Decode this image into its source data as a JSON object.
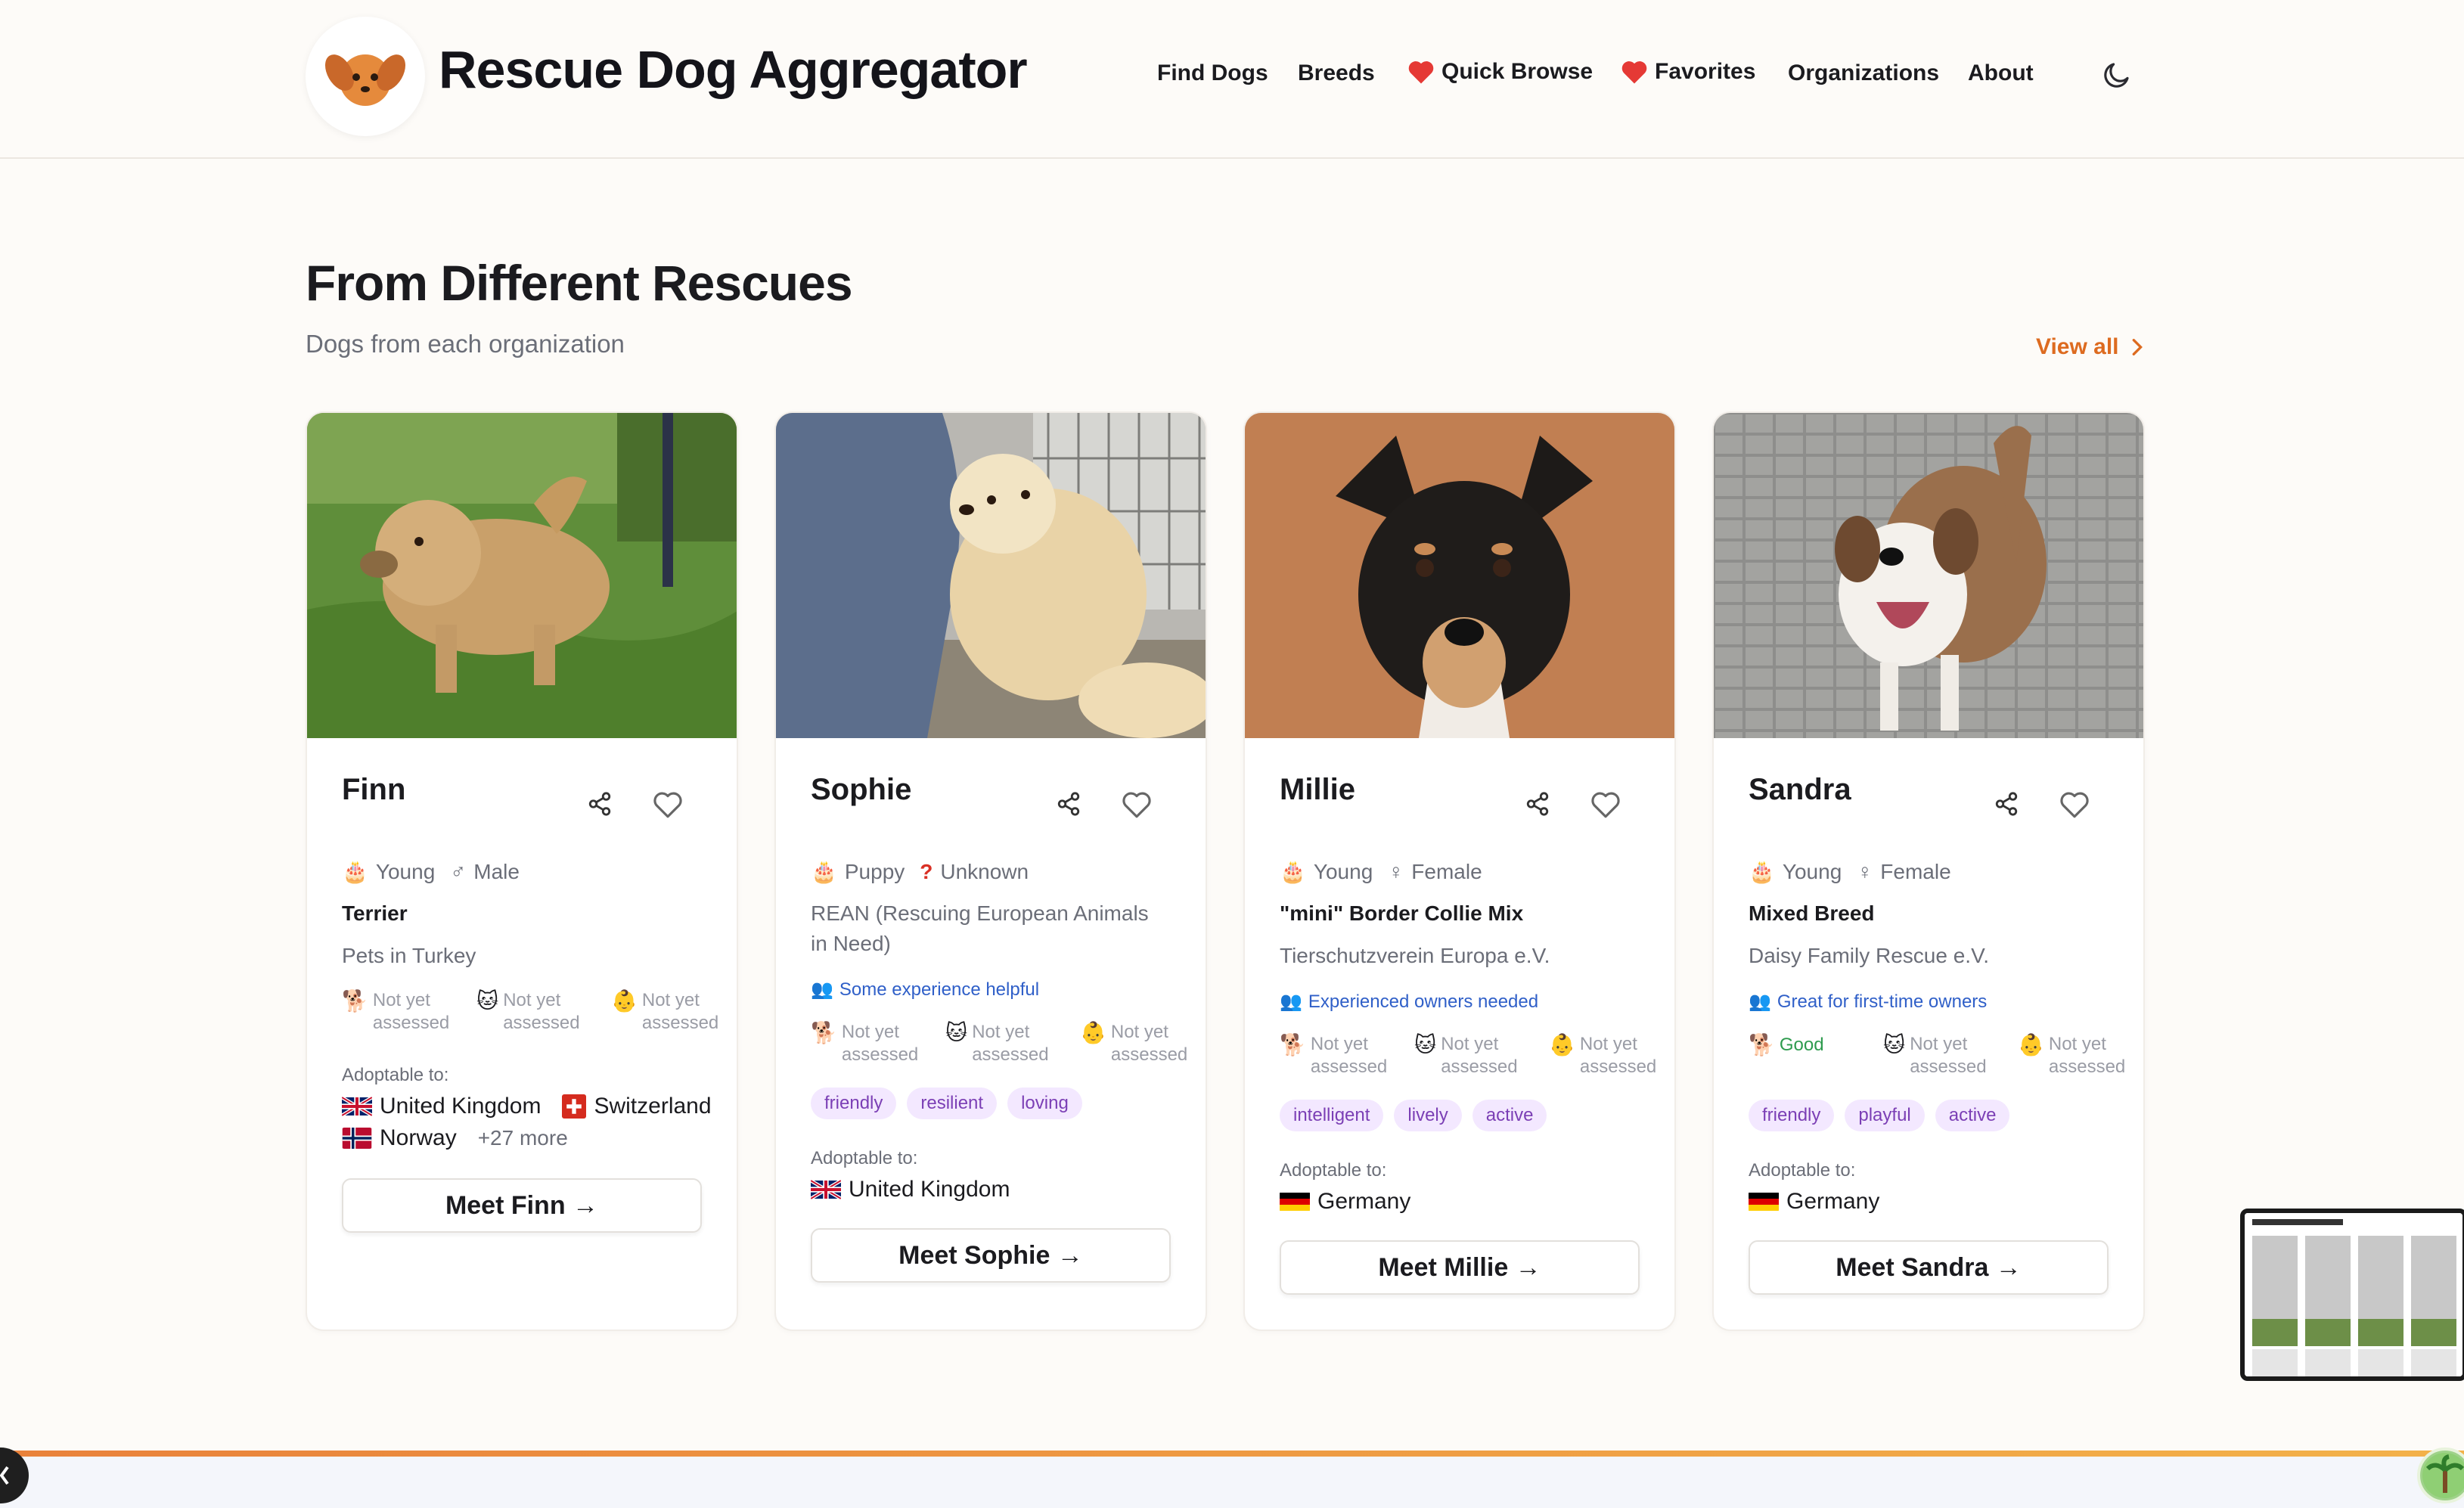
{
  "header": {
    "brand": "Rescue Dog Aggregator",
    "nav": [
      {
        "label": "Find Dogs",
        "icon": ""
      },
      {
        "label": "Breeds",
        "icon": ""
      },
      {
        "label": "Quick Browse",
        "icon": "heart-icon"
      },
      {
        "label": "Favorites",
        "icon": "heart-icon"
      },
      {
        "label": "Organizations",
        "icon": ""
      },
      {
        "label": "About",
        "icon": ""
      }
    ],
    "theme_icon": "moon-icon"
  },
  "section": {
    "title": "From Different Rescues",
    "subtitle": "Dogs from each organization",
    "view_all": "View all"
  },
  "colors": {
    "accent": "#dd6b20",
    "tag_bg": "#f3e8ff",
    "tag_text": "#7b3fb5",
    "experience": "#2f5fc8",
    "good": "#2e9b4e"
  },
  "cards": [
    {
      "name": "Finn",
      "age": "Young",
      "sex": "Male",
      "sex_icon": "male-icon",
      "breed": "Terrier",
      "org": "Pets in Turkey",
      "experience": "",
      "compat": [
        {
          "icon": "dog-icon",
          "text": "Not yet assessed"
        },
        {
          "icon": "cat-icon",
          "text": "Not yet assessed"
        },
        {
          "icon": "child-icon",
          "text": "Not yet assessed"
        }
      ],
      "tags": [],
      "adoptable_label": "Adoptable to:",
      "countries": [
        "United Kingdom",
        "Switzerland",
        "Norway"
      ],
      "more": "+27 more",
      "cta": "Meet Finn →"
    },
    {
      "name": "Sophie",
      "age": "Puppy",
      "sex": "Unknown",
      "sex_icon": "question-icon",
      "breed": "",
      "org": "REAN (Rescuing European Animals in Need)",
      "experience": "Some experience helpful",
      "compat": [
        {
          "icon": "dog-icon",
          "text": "Not yet assessed"
        },
        {
          "icon": "cat-icon",
          "text": "Not yet assessed"
        },
        {
          "icon": "child-icon",
          "text": "Not yet assessed"
        }
      ],
      "tags": [
        "friendly",
        "resilient",
        "loving"
      ],
      "adoptable_label": "Adoptable to:",
      "countries": [
        "United Kingdom"
      ],
      "more": "",
      "cta": "Meet Sophie →"
    },
    {
      "name": "Millie",
      "age": "Young",
      "sex": "Female",
      "sex_icon": "female-icon",
      "breed": "\"mini\" Border Collie Mix",
      "org": "Tierschutzverein Europa e.V.",
      "experience": "Experienced owners needed",
      "compat": [
        {
          "icon": "dog-icon",
          "text": "Not yet assessed"
        },
        {
          "icon": "cat-icon",
          "text": "Not yet assessed"
        },
        {
          "icon": "child-icon",
          "text": "Not yet assessed"
        }
      ],
      "tags": [
        "intelligent",
        "lively",
        "active"
      ],
      "adoptable_label": "Adoptable to:",
      "countries": [
        "Germany"
      ],
      "more": "",
      "cta": "Meet Millie →"
    },
    {
      "name": "Sandra",
      "age": "Young",
      "sex": "Female",
      "sex_icon": "female-icon",
      "breed": "Mixed Breed",
      "org": "Daisy Family Rescue e.V.",
      "experience": "Great for first-time owners",
      "compat": [
        {
          "icon": "dog-icon",
          "text": "Good"
        },
        {
          "icon": "cat-icon",
          "text": "Not yet assessed"
        },
        {
          "icon": "child-icon",
          "text": "Not yet assessed"
        }
      ],
      "tags": [
        "friendly",
        "playful",
        "active"
      ],
      "adoptable_label": "Adoptable to:",
      "countries": [
        "Germany"
      ],
      "more": "",
      "cta": "Meet Sandra →"
    }
  ]
}
